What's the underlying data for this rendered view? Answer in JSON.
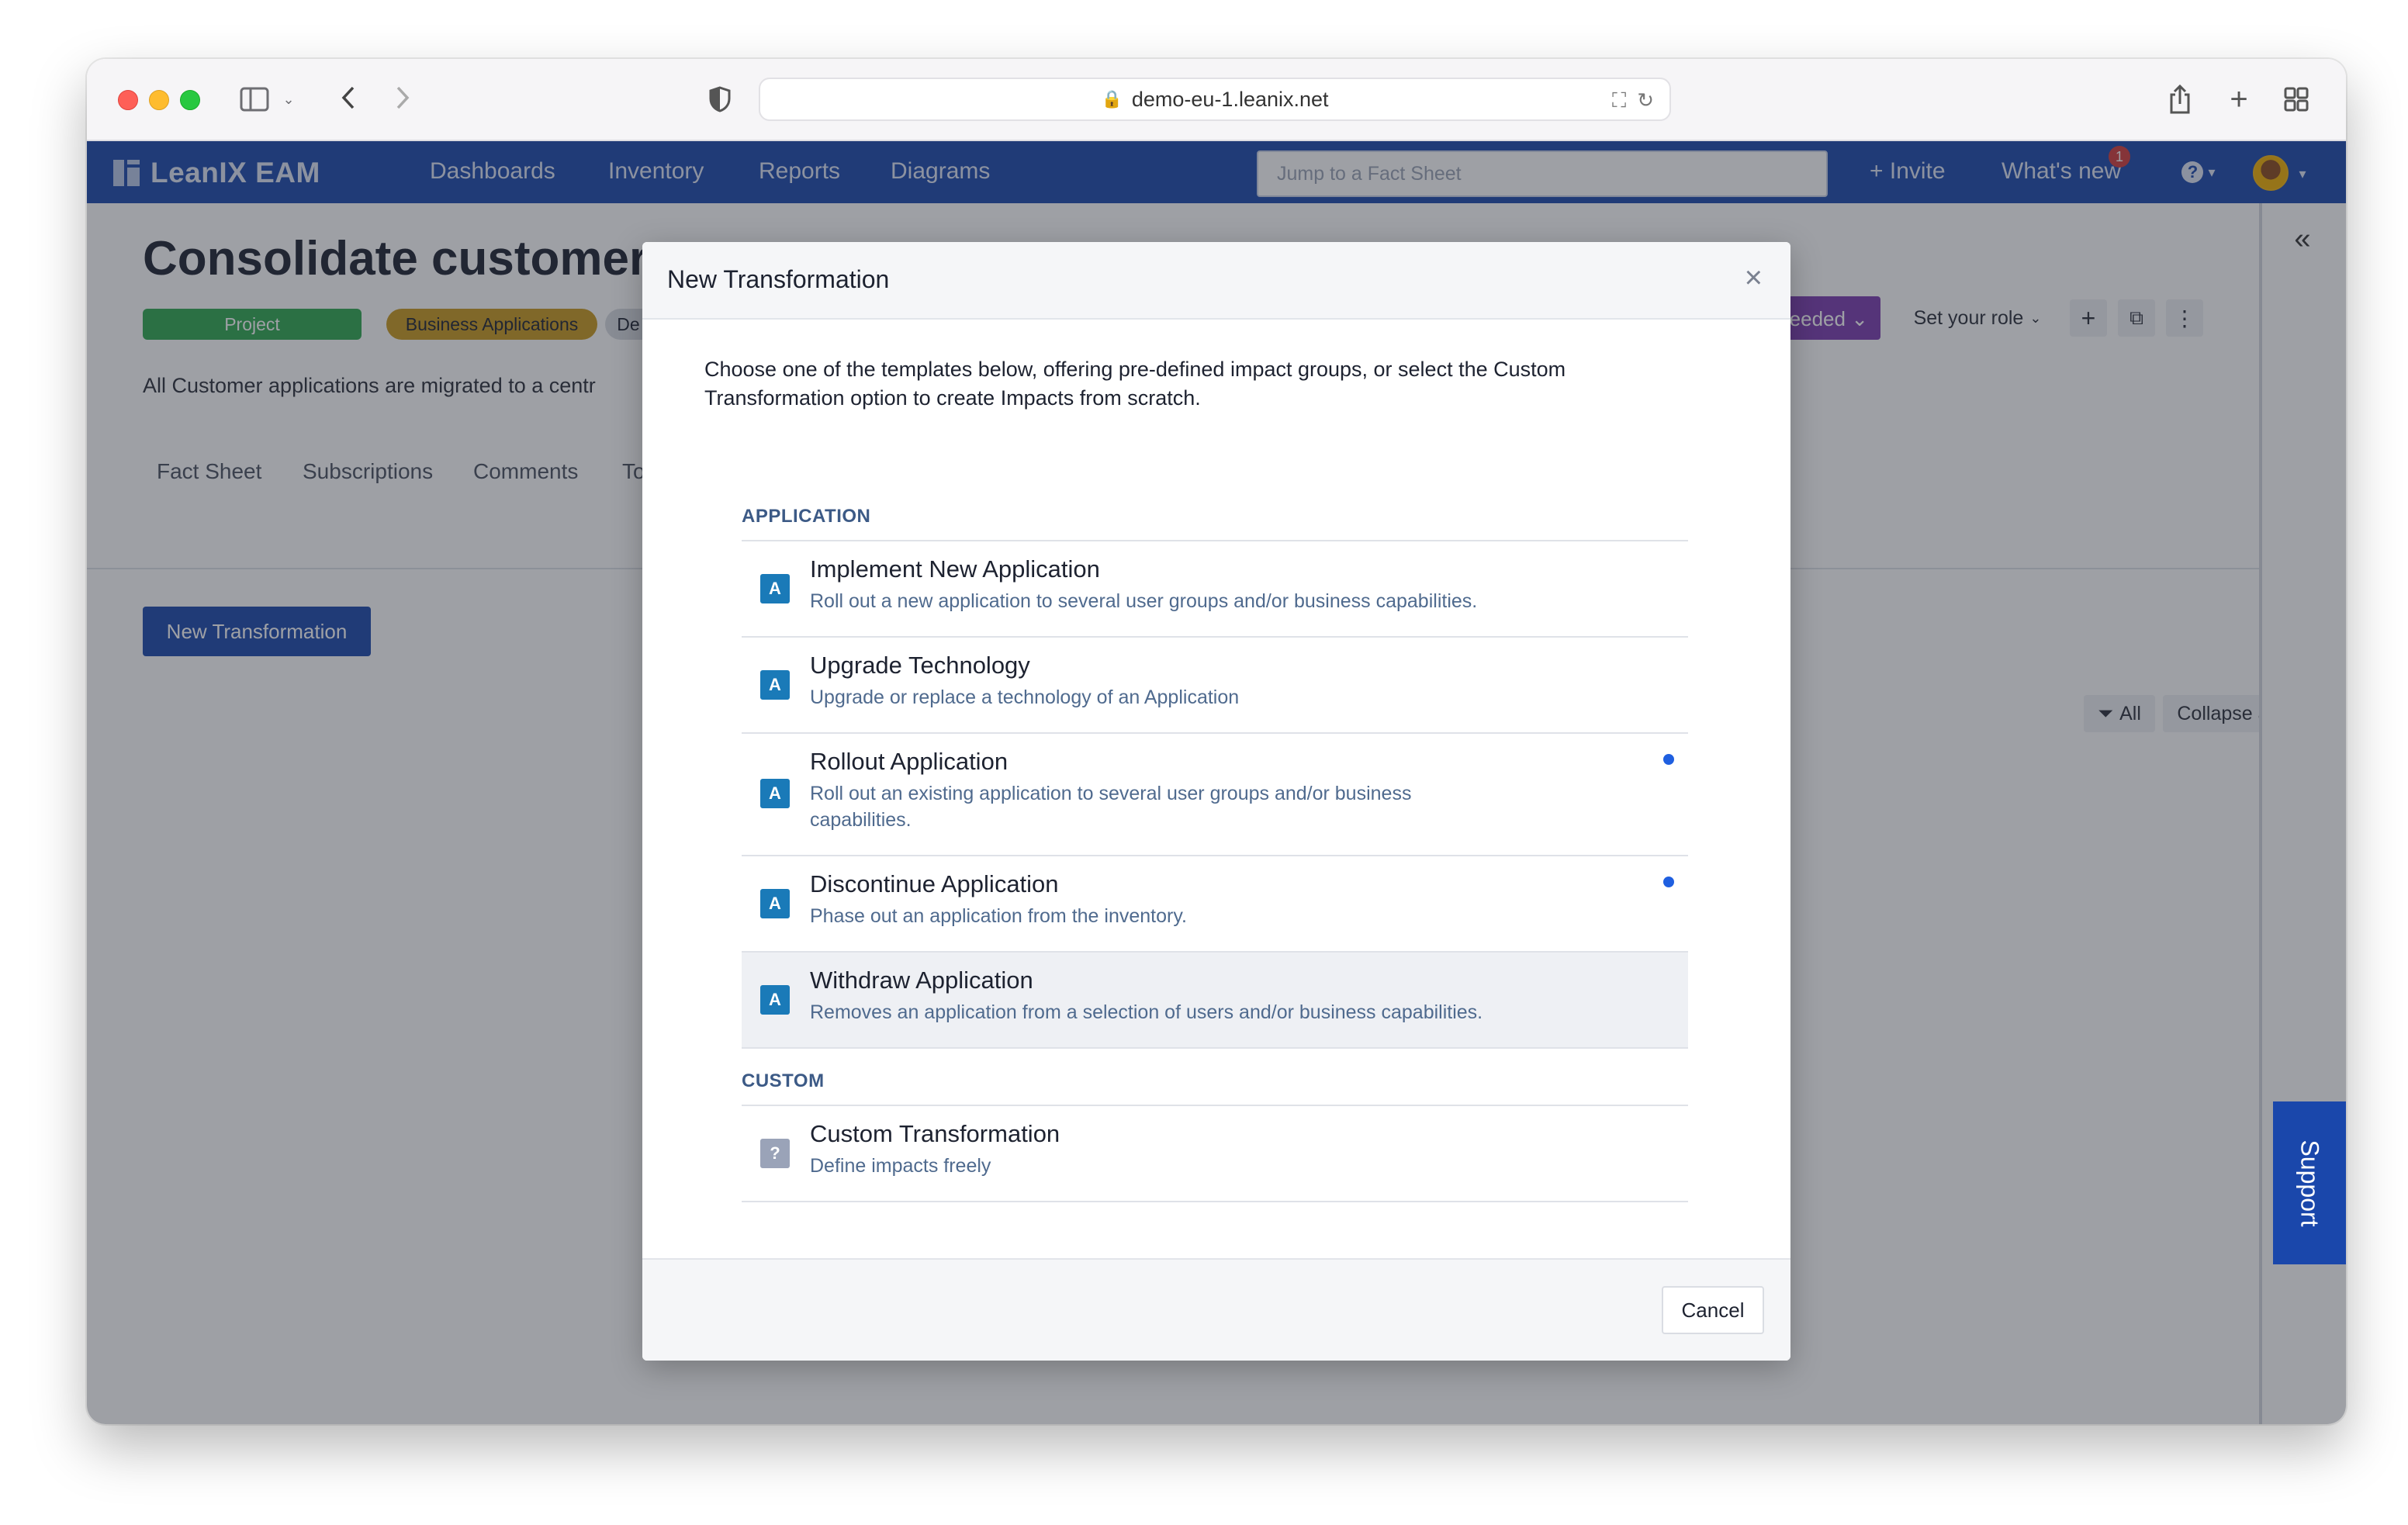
{
  "browser": {
    "url": "demo-eu-1.leanix.net"
  },
  "app": {
    "logo_text": "LeanIX EAM",
    "nav": [
      "Dashboards",
      "Inventory",
      "Reports",
      "Diagrams"
    ],
    "search_placeholder": "Jump to a Fact Sheet",
    "invite_label": "+ Invite",
    "whats_new_label": "What's new",
    "notification_count": "1",
    "help_icon": "?"
  },
  "page": {
    "title": "Consolidate customer",
    "pills": {
      "type": "Project",
      "category": "Business Applications",
      "extra": "De"
    },
    "description": "All Customer applications are migrated to a centr",
    "tabs": [
      "Fact Sheet",
      "Subscriptions",
      "Comments",
      "To"
    ],
    "new_transformation_button": "New Transformation",
    "status_pill": "needed",
    "set_role_label": "Set your role",
    "filter_all_label": "All",
    "collapse_all_label": "Collapse all",
    "support_label": "Support"
  },
  "modal": {
    "title": "New Transformation",
    "intro": "Choose one of the templates below, offering pre-defined impact groups, or select the Custom Transformation option to create Impacts from scratch.",
    "sections": [
      {
        "label": "APPLICATION",
        "items": [
          {
            "icon": "A",
            "title": "Implement New Application",
            "desc": "Roll out a new application to several user groups and/or business capabilities."
          },
          {
            "icon": "A",
            "title": "Upgrade Technology",
            "desc": "Upgrade or replace a technology of an Application"
          },
          {
            "icon": "A",
            "title": "Rollout Application",
            "desc": "Roll out an existing application to several user groups and/or business capabilities."
          },
          {
            "icon": "A",
            "title": "Discontinue Application",
            "desc": "Phase out an application from the inventory."
          },
          {
            "icon": "A",
            "title": "Withdraw Application",
            "desc": "Removes an application from a selection of users and/or business capabilities."
          }
        ]
      },
      {
        "label": "CUSTOM",
        "items": [
          {
            "icon": "?",
            "title": "Custom Transformation",
            "desc": "Define impacts freely"
          }
        ]
      }
    ],
    "cancel_label": "Cancel"
  },
  "colors": {
    "brand_blue": "#1a47ab",
    "application_icon": "#1a7ab8",
    "custom_icon": "#9aa3b8",
    "project_green": "#2fa84f",
    "business_app_gold": "#c99a1e",
    "status_purple": "#7a3bb0",
    "new_indicator": "#1f5fe0"
  }
}
